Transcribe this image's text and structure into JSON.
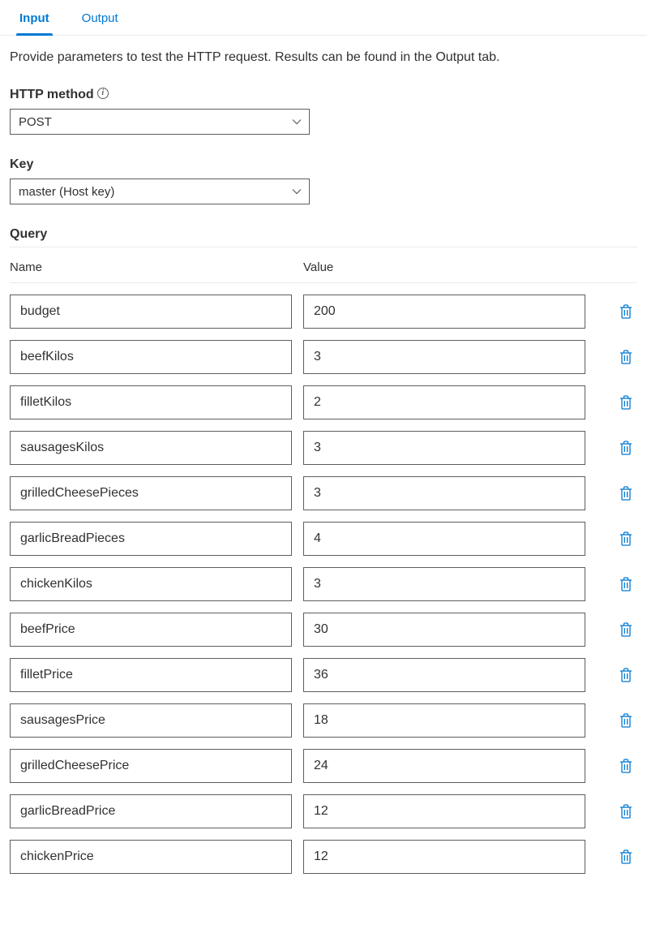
{
  "tabs": {
    "input": "Input",
    "output": "Output"
  },
  "intro": "Provide parameters to test the HTTP request. Results can be found in the Output tab.",
  "httpMethod": {
    "label": "HTTP method",
    "value": "POST"
  },
  "key": {
    "label": "Key",
    "value": "master (Host key)"
  },
  "query": {
    "title": "Query",
    "nameHeader": "Name",
    "valueHeader": "Value",
    "rows": [
      {
        "name": "budget",
        "value": "200"
      },
      {
        "name": "beefKilos",
        "value": "3"
      },
      {
        "name": "filletKilos",
        "value": "2"
      },
      {
        "name": "sausagesKilos",
        "value": "3"
      },
      {
        "name": "grilledCheesePieces",
        "value": "3"
      },
      {
        "name": "garlicBreadPieces",
        "value": "4"
      },
      {
        "name": "chickenKilos",
        "value": "3"
      },
      {
        "name": "beefPrice",
        "value": "30"
      },
      {
        "name": "filletPrice",
        "value": "36"
      },
      {
        "name": "sausagesPrice",
        "value": "18"
      },
      {
        "name": "grilledCheesePrice",
        "value": "24"
      },
      {
        "name": "garlicBreadPrice",
        "value": "12"
      },
      {
        "name": "chickenPrice",
        "value": "12"
      }
    ]
  }
}
